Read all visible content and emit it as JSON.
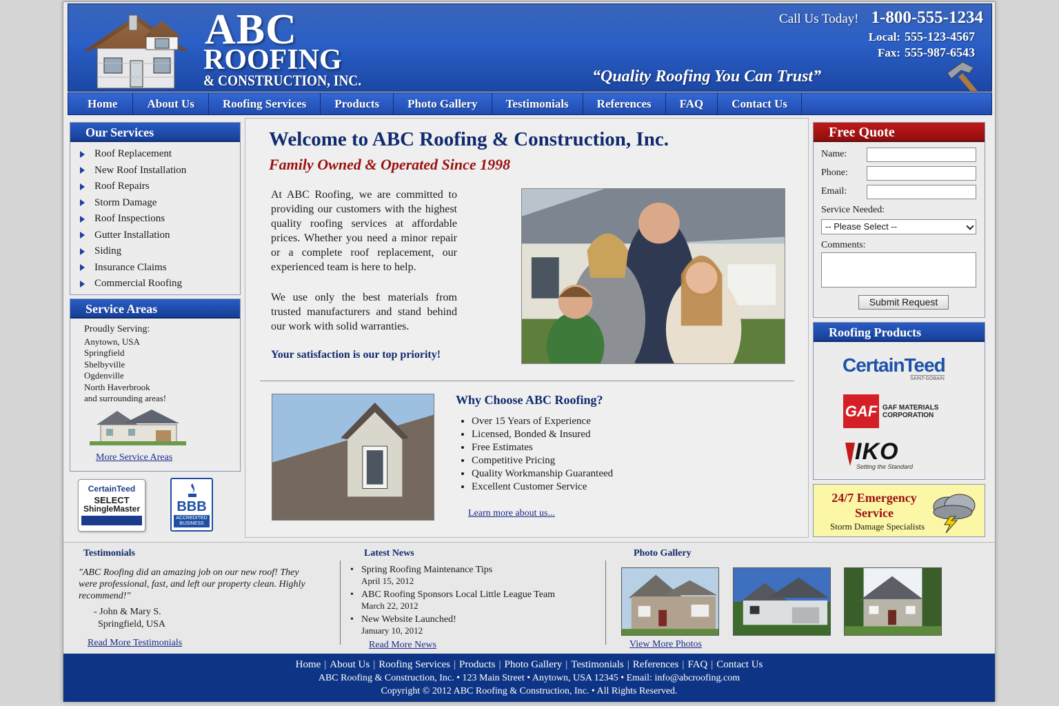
{
  "header": {
    "brand_line1": "ABC",
    "brand_line2": "ROOFING",
    "brand_line3": "& CONSTRUCTION, INC.",
    "call_label": "Call Us Today!",
    "call_number": "1-800-555-1234",
    "local_label": "Local:",
    "local_number": "555-123-4567",
    "fax_label": "Fax:",
    "fax_number": "555-987-6543",
    "slogan": "“Quality Roofing You Can Trust”"
  },
  "nav": [
    "Home",
    "About Us",
    "Roofing Services",
    "Products",
    "Photo Gallery",
    "Testimonials",
    "References",
    "FAQ",
    "Contact Us"
  ],
  "services": {
    "title": "Our Services",
    "items": [
      "Roof Replacement",
      "New Roof Installation",
      "Roof Repairs",
      "Storm Damage",
      "Roof Inspections",
      "Gutter Installation",
      "Siding",
      "Insurance Claims",
      "Commercial Roofing"
    ]
  },
  "areas": {
    "title": "Service Areas",
    "intro": "Proudly Serving:",
    "items": [
      "Anytown, USA",
      "Springfield",
      "Shelbyville",
      "Ogdenville",
      "North Haverbrook",
      "and surrounding areas!"
    ],
    "more_link": "More Service Areas"
  },
  "badges": {
    "ct_line1": "CertainTeed",
    "ct_line2": "SELECT",
    "ct_line3": "ShingleMaster",
    "bbb_label": "BBB",
    "bbb_sub": "ACCREDITED BUSINESS"
  },
  "main": {
    "welcome": "Welcome to ABC Roofing & Construction, Inc.",
    "tagline": "Family Owned & Operated Since 1998",
    "para1": "At ABC Roofing, we are committed to providing our customers with the highest quality roofing services at affordable prices. Whether you need a minor repair or a complete roof replacement, our experienced team is here to help.",
    "para2": "We use only the best materials from trusted manufacturers and stand behind our work with solid warranties.",
    "priority": "Your satisfaction is our top priority!",
    "why_title": "Why Choose ABC Roofing?",
    "why_items": [
      "Over 15 Years of Experience",
      "Licensed, Bonded & Insured",
      "Free Estimates",
      "Competitive Pricing",
      "Quality Workmanship Guaranteed",
      "Excellent Customer Service"
    ],
    "learn_more": "Learn more about us..."
  },
  "quote": {
    "title": "Free Quote",
    "name_label": "Name:",
    "phone_label": "Phone:",
    "email_label": "Email:",
    "service_label": "Service Needed:",
    "service_selected": "-- Please Select --",
    "comments_label": "Comments:",
    "submit": "Submit Request"
  },
  "products": {
    "title": "Roofing Products",
    "ct_name": "CertainTeed",
    "ct_sub": "SAINT-GOBAIN",
    "gaf_name": "GAF",
    "gaf_text1": "GAF MATERIALS",
    "gaf_text2": "CORPORATION",
    "iko_name": "IKO",
    "iko_sub": "Setting the Standard"
  },
  "emergency": {
    "title": "24/7 Emergency Service",
    "subtitle": "Storm Damage Specialists"
  },
  "bottom": {
    "testimonials_title": "Testimonials",
    "testimonial_text": "\"ABC Roofing did an amazing job on our new roof! They were professional, fast, and left our property clean. Highly recommend!\"",
    "testimonial_by": "- John & Mary S.",
    "testimonial_city": "Springfield, USA",
    "read_testimonials": "Read More Testimonials",
    "news_title": "Latest News",
    "news": [
      {
        "title": "Spring Roofing Maintenance Tips",
        "date": "April 15, 2012"
      },
      {
        "title": "ABC Roofing Sponsors Local Little League Team",
        "date": "March 22, 2012"
      },
      {
        "title": "New Website Launched!",
        "date": "January 10, 2012"
      }
    ],
    "read_news": "Read More News",
    "gallery_title": "Photo Gallery",
    "view_photos": "View More Photos"
  },
  "footer": {
    "nav": [
      "Home",
      "About Us",
      "Roofing Services",
      "Products",
      "Photo Gallery",
      "Testimonials",
      "References",
      "FAQ",
      "Contact Us"
    ],
    "info": "ABC Roofing & Construction, Inc.  •  123 Main Street  •  Anytown, USA 12345  •  Email: info@abcroofing.com",
    "copyright": "Copyright © 2012 ABC Roofing & Construction, Inc.  •  All Rights Reserved."
  },
  "colors": {
    "brand_blue": "#1e4fb3",
    "dark_blue": "#0e3585",
    "accent_red": "#9a1010",
    "emergency_yellow": "#fbf7a6"
  }
}
